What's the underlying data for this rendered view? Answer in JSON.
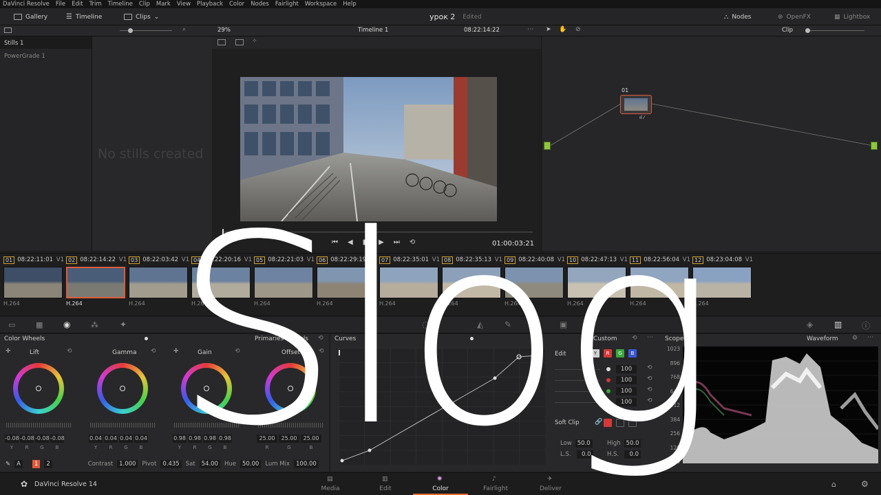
{
  "menu": [
    "DaVinci Resolve",
    "File",
    "Edit",
    "Trim",
    "Timeline",
    "Clip",
    "Mark",
    "View",
    "Playback",
    "Color",
    "Nodes",
    "Fairlight",
    "Workspace",
    "Help"
  ],
  "toolbar": {
    "gallery": "Gallery",
    "timeline": "Timeline",
    "clips": "Clips",
    "project_title": "урок 2",
    "edited": "Edited",
    "nodes": "Nodes",
    "openfx": "OpenFX",
    "lightbox": "Lightbox"
  },
  "subbar": {
    "zoom": "29%",
    "timeline_name": "Timeline 1",
    "timecode": "08:22:14:22",
    "clip_mode": "Clip"
  },
  "gallery": {
    "albums": [
      "Stills 1",
      "PowerGrade 1"
    ],
    "empty_message": "No stills created"
  },
  "viewer": {
    "playhead_timecode": "01:00:03:21"
  },
  "nodes": {
    "node_label": "01"
  },
  "clips": [
    {
      "num": "01",
      "tc": "08:22:11:01",
      "track": "V1",
      "codec": "H.264",
      "c1": "#3d4e66",
      "c2": "#8a8578"
    },
    {
      "num": "02",
      "tc": "08:22:14:22",
      "track": "V1",
      "codec": "H.264",
      "c1": "#4a5d78",
      "c2": "#7a7a72"
    },
    {
      "num": "03",
      "tc": "08:22:03:42",
      "track": "V1",
      "codec": "H.264",
      "c1": "#5f7491",
      "c2": "#a29c8f"
    },
    {
      "num": "04",
      "tc": "08:22:20:16",
      "track": "V1",
      "codec": "H.264",
      "c1": "#6b82a0",
      "c2": "#b1ab9e"
    },
    {
      "num": "05",
      "tc": "08:22:21:03",
      "track": "V1",
      "codec": "H.264",
      "c1": "#6d83a1",
      "c2": "#9d978a"
    },
    {
      "num": "06",
      "tc": "08:22:29:19",
      "track": "V1",
      "codec": "H.264",
      "c1": "#7f95b0",
      "c2": "#8d8475"
    },
    {
      "num": "07",
      "tc": "08:22:35:01",
      "track": "V1",
      "codec": "H.264",
      "c1": "#8ea3bd",
      "c2": "#b7ad9c"
    },
    {
      "num": "08",
      "tc": "08:22:35:13",
      "track": "V1",
      "codec": "H.264",
      "c1": "#8ca0b9",
      "c2": "#c2b8a6"
    },
    {
      "num": "09",
      "tc": "08:22:40:08",
      "track": "V1",
      "codec": "H.264",
      "c1": "#7c92ae",
      "c2": "#8f8a7e"
    },
    {
      "num": "10",
      "tc": "08:22:47:13",
      "track": "V1",
      "codec": "H.264",
      "c1": "#93a6bd",
      "c2": "#c9c1b1"
    },
    {
      "num": "11",
      "tc": "08:22:56:04",
      "track": "V1",
      "codec": "H.264",
      "c1": "#8fa5c0",
      "c2": "#c0b7a5"
    },
    {
      "num": "12",
      "tc": "08:23:04:08",
      "track": "V1",
      "codec": "H.264",
      "c1": "#8aa2c2",
      "c2": "#b9b3a6"
    }
  ],
  "color_wheels": {
    "title": "Color Wheels",
    "mode": "Primaries Wheels",
    "wheels": [
      {
        "name": "Lift",
        "values": [
          "-0.08",
          "-0.08",
          "-0.08",
          "-0.08"
        ]
      },
      {
        "name": "Gamma",
        "values": [
          "0.04",
          "0.04",
          "0.04",
          "0.04"
        ]
      },
      {
        "name": "Gain",
        "values": [
          "0.98",
          "0.98",
          "0.98",
          "0.98"
        ]
      },
      {
        "name": "Offset",
        "values": [
          "25.00",
          "25.00",
          "25.00"
        ]
      }
    ],
    "channels4": [
      "Y",
      "R",
      "G",
      "B"
    ],
    "channels3": [
      "R",
      "G",
      "B"
    ],
    "page1": "1",
    "page2": "2",
    "contrast_label": "Contrast",
    "contrast": "1.000",
    "pivot_label": "Pivot",
    "pivot": "0.435",
    "sat_label": "Sat",
    "sat": "54.00",
    "hue_label": "Hue",
    "hue": "50.00",
    "lummix_label": "Lum Mix",
    "lummix": "100.00",
    "auto": "A"
  },
  "curves": {
    "title": "Curves",
    "mode": "Custom",
    "edit_label": "Edit",
    "channels": [
      "Y",
      "R",
      "G",
      "B"
    ],
    "intensities": [
      "100",
      "100",
      "100",
      "100"
    ],
    "soft_clip": "Soft Clip",
    "low_label": "Low",
    "low": "50.0",
    "high_label": "High",
    "high": "50.0",
    "ls_label": "L.S.",
    "ls": "0.0",
    "hs_label": "H.S.",
    "hs": "0.0"
  },
  "scope": {
    "title": "Scope",
    "mode": "Waveform",
    "ticks": [
      "1023",
      "896",
      "768",
      "640",
      "512",
      "384",
      "256",
      "128",
      "0"
    ]
  },
  "pages": {
    "app_name": "DaVinci Resolve 14",
    "tabs": [
      "Media",
      "Edit",
      "Color",
      "Fairlight",
      "Deliver"
    ]
  },
  "overlay": {
    "text": "Slog"
  },
  "colors": {
    "accent_orange": "#e66a2c",
    "clip_border": "#d4a12b",
    "active_clip": "#e05a3a",
    "node_green": "#8ec63f"
  }
}
